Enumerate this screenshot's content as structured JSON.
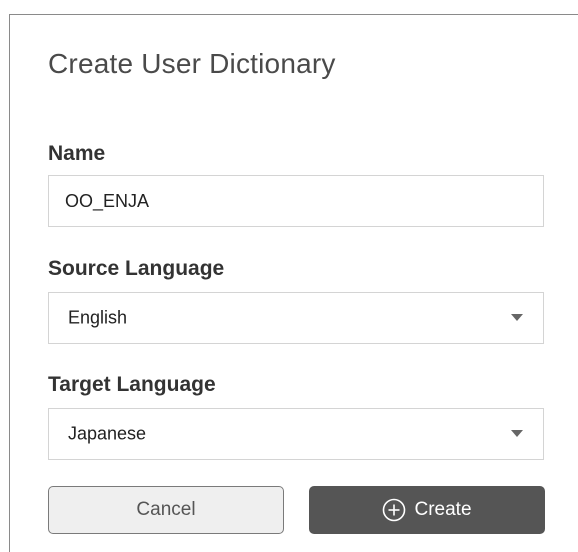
{
  "dialog": {
    "title": "Create User Dictionary"
  },
  "name_field": {
    "label": "Name",
    "value": "OO_ENJA"
  },
  "source_language": {
    "label": "Source Language",
    "selected": "English",
    "icon": "chevron-down-icon"
  },
  "target_language": {
    "label": "Target Language",
    "selected": "Japanese",
    "icon": "chevron-down-icon"
  },
  "actions": {
    "cancel_label": "Cancel",
    "create_label": "Create",
    "create_icon": "plus-circle-icon"
  },
  "colors": {
    "primary_button": "#555555",
    "secondary_button": "#efefef",
    "input_border": "#d4d4d4",
    "label_text": "#333333"
  }
}
